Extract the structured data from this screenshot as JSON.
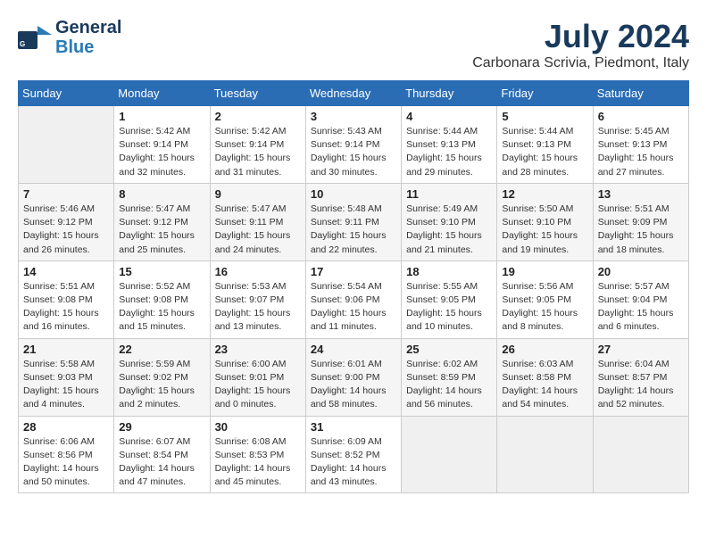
{
  "header": {
    "logo_line1": "General",
    "logo_line2": "Blue",
    "month_year": "July 2024",
    "location": "Carbonara Scrivia, Piedmont, Italy"
  },
  "weekdays": [
    "Sunday",
    "Monday",
    "Tuesday",
    "Wednesday",
    "Thursday",
    "Friday",
    "Saturday"
  ],
  "weeks": [
    [
      {
        "day": "",
        "info": ""
      },
      {
        "day": "1",
        "info": "Sunrise: 5:42 AM\nSunset: 9:14 PM\nDaylight: 15 hours\nand 32 minutes."
      },
      {
        "day": "2",
        "info": "Sunrise: 5:42 AM\nSunset: 9:14 PM\nDaylight: 15 hours\nand 31 minutes."
      },
      {
        "day": "3",
        "info": "Sunrise: 5:43 AM\nSunset: 9:14 PM\nDaylight: 15 hours\nand 30 minutes."
      },
      {
        "day": "4",
        "info": "Sunrise: 5:44 AM\nSunset: 9:13 PM\nDaylight: 15 hours\nand 29 minutes."
      },
      {
        "day": "5",
        "info": "Sunrise: 5:44 AM\nSunset: 9:13 PM\nDaylight: 15 hours\nand 28 minutes."
      },
      {
        "day": "6",
        "info": "Sunrise: 5:45 AM\nSunset: 9:13 PM\nDaylight: 15 hours\nand 27 minutes."
      }
    ],
    [
      {
        "day": "7",
        "info": "Sunrise: 5:46 AM\nSunset: 9:12 PM\nDaylight: 15 hours\nand 26 minutes."
      },
      {
        "day": "8",
        "info": "Sunrise: 5:47 AM\nSunset: 9:12 PM\nDaylight: 15 hours\nand 25 minutes."
      },
      {
        "day": "9",
        "info": "Sunrise: 5:47 AM\nSunset: 9:11 PM\nDaylight: 15 hours\nand 24 minutes."
      },
      {
        "day": "10",
        "info": "Sunrise: 5:48 AM\nSunset: 9:11 PM\nDaylight: 15 hours\nand 22 minutes."
      },
      {
        "day": "11",
        "info": "Sunrise: 5:49 AM\nSunset: 9:10 PM\nDaylight: 15 hours\nand 21 minutes."
      },
      {
        "day": "12",
        "info": "Sunrise: 5:50 AM\nSunset: 9:10 PM\nDaylight: 15 hours\nand 19 minutes."
      },
      {
        "day": "13",
        "info": "Sunrise: 5:51 AM\nSunset: 9:09 PM\nDaylight: 15 hours\nand 18 minutes."
      }
    ],
    [
      {
        "day": "14",
        "info": "Sunrise: 5:51 AM\nSunset: 9:08 PM\nDaylight: 15 hours\nand 16 minutes."
      },
      {
        "day": "15",
        "info": "Sunrise: 5:52 AM\nSunset: 9:08 PM\nDaylight: 15 hours\nand 15 minutes."
      },
      {
        "day": "16",
        "info": "Sunrise: 5:53 AM\nSunset: 9:07 PM\nDaylight: 15 hours\nand 13 minutes."
      },
      {
        "day": "17",
        "info": "Sunrise: 5:54 AM\nSunset: 9:06 PM\nDaylight: 15 hours\nand 11 minutes."
      },
      {
        "day": "18",
        "info": "Sunrise: 5:55 AM\nSunset: 9:05 PM\nDaylight: 15 hours\nand 10 minutes."
      },
      {
        "day": "19",
        "info": "Sunrise: 5:56 AM\nSunset: 9:05 PM\nDaylight: 15 hours\nand 8 minutes."
      },
      {
        "day": "20",
        "info": "Sunrise: 5:57 AM\nSunset: 9:04 PM\nDaylight: 15 hours\nand 6 minutes."
      }
    ],
    [
      {
        "day": "21",
        "info": "Sunrise: 5:58 AM\nSunset: 9:03 PM\nDaylight: 15 hours\nand 4 minutes."
      },
      {
        "day": "22",
        "info": "Sunrise: 5:59 AM\nSunset: 9:02 PM\nDaylight: 15 hours\nand 2 minutes."
      },
      {
        "day": "23",
        "info": "Sunrise: 6:00 AM\nSunset: 9:01 PM\nDaylight: 15 hours\nand 0 minutes."
      },
      {
        "day": "24",
        "info": "Sunrise: 6:01 AM\nSunset: 9:00 PM\nDaylight: 14 hours\nand 58 minutes."
      },
      {
        "day": "25",
        "info": "Sunrise: 6:02 AM\nSunset: 8:59 PM\nDaylight: 14 hours\nand 56 minutes."
      },
      {
        "day": "26",
        "info": "Sunrise: 6:03 AM\nSunset: 8:58 PM\nDaylight: 14 hours\nand 54 minutes."
      },
      {
        "day": "27",
        "info": "Sunrise: 6:04 AM\nSunset: 8:57 PM\nDaylight: 14 hours\nand 52 minutes."
      }
    ],
    [
      {
        "day": "28",
        "info": "Sunrise: 6:06 AM\nSunset: 8:56 PM\nDaylight: 14 hours\nand 50 minutes."
      },
      {
        "day": "29",
        "info": "Sunrise: 6:07 AM\nSunset: 8:54 PM\nDaylight: 14 hours\nand 47 minutes."
      },
      {
        "day": "30",
        "info": "Sunrise: 6:08 AM\nSunset: 8:53 PM\nDaylight: 14 hours\nand 45 minutes."
      },
      {
        "day": "31",
        "info": "Sunrise: 6:09 AM\nSunset: 8:52 PM\nDaylight: 14 hours\nand 43 minutes."
      },
      {
        "day": "",
        "info": ""
      },
      {
        "day": "",
        "info": ""
      },
      {
        "day": "",
        "info": ""
      }
    ]
  ]
}
